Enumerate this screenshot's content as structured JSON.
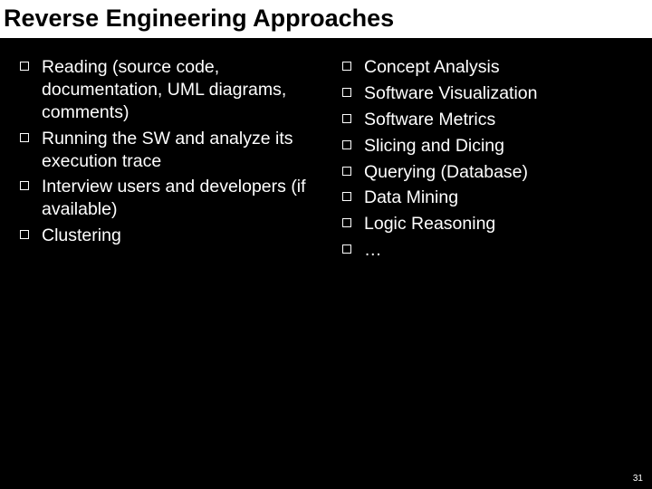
{
  "title": "Reverse Engineering Approaches",
  "left_column": [
    "Reading (source code, documentation, UML diagrams, comments)",
    "Running the SW and analyze its execution trace",
    "Interview users and developers (if available)",
    "Clustering"
  ],
  "right_column": [
    "Concept Analysis",
    "Software Visualization",
    "Software Metrics",
    "Slicing and Dicing",
    "Querying (Database)",
    "Data Mining",
    "Logic Reasoning",
    "…"
  ],
  "page_number": "31"
}
